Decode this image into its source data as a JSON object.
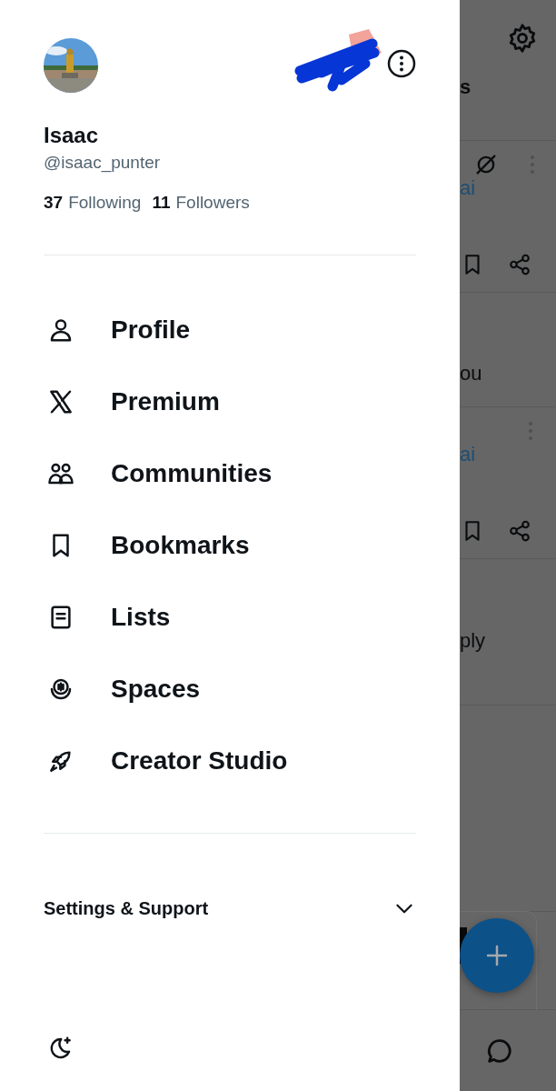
{
  "profile": {
    "name": "Isaac",
    "handle": "@isaac_punter",
    "following_count": "37",
    "following_label": "Following",
    "followers_count": "11",
    "followers_label": "Followers"
  },
  "menu": [
    {
      "kind": "profile",
      "label": "Profile"
    },
    {
      "kind": "premium",
      "label": "Premium"
    },
    {
      "kind": "communities",
      "label": "Communities"
    },
    {
      "kind": "bookmarks",
      "label": "Bookmarks"
    },
    {
      "kind": "lists",
      "label": "Lists"
    },
    {
      "kind": "spaces",
      "label": "Spaces"
    },
    {
      "kind": "creator",
      "label": "Creator Studio"
    }
  ],
  "settings_section": {
    "label": "Settings & Support",
    "expanded": false
  },
  "background": {
    "rows": [
      {
        "kind": "heading",
        "text": "s"
      },
      {
        "kind": "post",
        "text": "ai",
        "muted_icon": true
      },
      {
        "kind": "line",
        "text": "ou"
      },
      {
        "kind": "post",
        "text": "ai",
        "muted_icon": false
      },
      {
        "kind": "line",
        "text": "ply"
      },
      {
        "kind": "compose"
      }
    ]
  }
}
